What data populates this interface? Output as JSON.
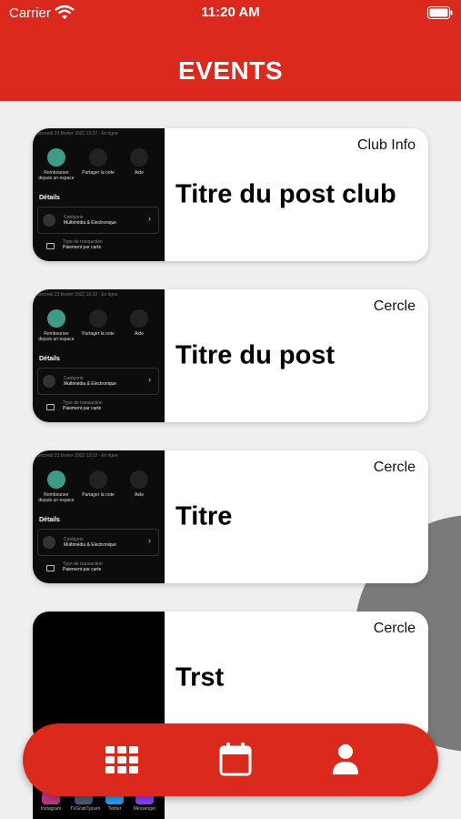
{
  "status_bar": {
    "carrier": "Carrier",
    "time": "11:20 AM"
  },
  "header": {
    "title": "EVENTS"
  },
  "thumbnail": {
    "top_text": "mercredi 23 février 2022 13:22 · En ligne",
    "actions": [
      {
        "label": "Rembourser depuis un espace",
        "color": "#3e9c86"
      },
      {
        "label": "Partager la note"
      },
      {
        "label": "Aide"
      }
    ],
    "details": "Détails",
    "category_label": "Catégorie",
    "category_value": "Multimédia & Electronique",
    "transaction_label": "Type de transaction",
    "transaction_value": "Paiement par carte"
  },
  "cards": [
    {
      "tag": "Club Info",
      "title": "Titre du post club"
    },
    {
      "tag": "Cercle",
      "title": "Titre du post"
    },
    {
      "tag": "Cercle",
      "title": "Titre"
    },
    {
      "tag": "Cercle",
      "title": "Trst"
    }
  ],
  "behind_apps": [
    "Instagram",
    "TVGrabTyssen",
    "Twitter",
    "Messenger"
  ],
  "bottom_nav": {
    "items": [
      {
        "icon": "grid-icon"
      },
      {
        "icon": "calendar-icon"
      },
      {
        "icon": "profile-icon"
      }
    ]
  },
  "colors": {
    "brand": "#dc291e",
    "background": "#efefef",
    "accent_green": "#3e9c86"
  }
}
